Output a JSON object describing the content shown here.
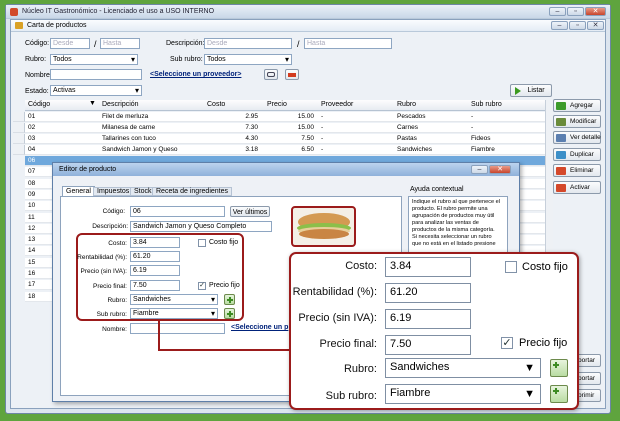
{
  "window": {
    "title": "Núcleo IT Gastronómico - Licenciado el uso a USO INTERNO"
  },
  "inner_window": {
    "title": "Carta de productos"
  },
  "filters": {
    "codigo_label": "Código:",
    "codigo_desde": "Desde",
    "codigo_sep": "/",
    "codigo_hasta": "Hasta",
    "descripcion_label": "Descripción:",
    "descripcion_desde": "Desde",
    "descripcion_sep": "/",
    "descripcion_hasta": "Hasta",
    "rubro_label": "Rubro:",
    "rubro_value": "Todos",
    "subrubro_label": "Sub rubro:",
    "subrubro_value": "Todos",
    "nombre_label": "Nombre:",
    "proveedor_link": "<Seleccione un proveedor>",
    "estado_label": "Estado:",
    "estado_value": "Activas",
    "listar_button": "Listar"
  },
  "grid": {
    "columns": [
      "Código",
      "Descripción",
      "Costo",
      "Precio",
      "Proveedor",
      "Rubro",
      "Sub rubro"
    ],
    "rows": [
      {
        "codigo": "01",
        "descripcion": "Filet de merluza",
        "costo": "2.95",
        "precio": "15.00",
        "proveedor": "-",
        "rubro": "Pescados",
        "subrubro": "-"
      },
      {
        "codigo": "02",
        "descripcion": "Milanesa de carne",
        "costo": "7.30",
        "precio": "15.00",
        "proveedor": "-",
        "rubro": "Carnes",
        "subrubro": "-"
      },
      {
        "codigo": "03",
        "descripcion": "Tallarines con tuco",
        "costo": "4.30",
        "precio": "7.50",
        "proveedor": "-",
        "rubro": "Pastas",
        "subrubro": "Fideos"
      },
      {
        "codigo": "04",
        "descripcion": "Sandwich Jamon y Queso",
        "costo": "3.18",
        "precio": "6.50",
        "proveedor": "-",
        "rubro": "Sandwiches",
        "subrubro": "Fiambre"
      }
    ],
    "row_codes_below": [
      "06",
      "07",
      "08",
      "09",
      "10",
      "11",
      "12",
      "13",
      "14",
      "15",
      "16",
      "17",
      "18"
    ]
  },
  "side_buttons": [
    "Agregar",
    "Modificar",
    "Ver detalle",
    "Duplicar",
    "Eliminar",
    "Activar",
    "Importar",
    "Exportar",
    "Imprimir"
  ],
  "side_buttons_visible": [
    "portar",
    "portar",
    "primir"
  ],
  "dialog": {
    "title": "Editor de producto",
    "tabs": [
      "General",
      "Impuestos",
      "Stock",
      "Receta de ingredientes"
    ],
    "codigo_label": "Código:",
    "codigo_value": "06",
    "ver_ultimos_button": "Ver últimos",
    "descripcion_label": "Descripción:",
    "descripcion_value": "Sandwich Jamon y Queso Completo",
    "costo_label": "Costo:",
    "costo_value": "3.84",
    "costo_fijo_label": "Costo fijo",
    "rentabilidad_label": "Rentabilidad (%):",
    "rentabilidad_value": "61.20",
    "precio_siniva_label": "Precio (sin IVA):",
    "precio_siniva_value": "6.19",
    "precio_final_label": "Precio final:",
    "precio_final_value": "7.50",
    "precio_fijo_label": "Precio fijo",
    "rubro_label": "Rubro:",
    "rubro_value": "Sandwiches",
    "subrubro_label": "Sub rubro:",
    "subrubro_value": "Fiambre",
    "nombre_label": "Nombre:",
    "proveedor_link": "<Seleccione un p",
    "help_title": "Ayuda contextual",
    "help_text": "Indique el rubro al que pertenece el producto. El rubro permite una agrupación de productos muy útil para analizar las ventas de productos de la misma categoría. Si necesita seleccionar un rubro que no está en el listado presione"
  },
  "zoom": {
    "costo_label": "Costo:",
    "costo_value": "3.84",
    "costo_fijo_label": "Costo fijo",
    "rentabilidad_label": "Rentabilidad (%):",
    "rentabilidad_value": "61.20",
    "precio_siniva_label": "Precio (sin IVA):",
    "precio_siniva_value": "6.19",
    "precio_final_label": "Precio final:",
    "precio_final_value": "7.50",
    "precio_fijo_label": "Precio fijo",
    "rubro_label": "Rubro:",
    "rubro_value": "Sandwiches",
    "subrubro_label": "Sub rubro:",
    "subrubro_value": "Fiambre"
  },
  "colors": {
    "accent": "#6fa8dc",
    "highlight_border": "#9b1b1b",
    "background": "#5fa43e"
  },
  "checked": {
    "costo_fijo": false,
    "precio_fijo": true
  }
}
